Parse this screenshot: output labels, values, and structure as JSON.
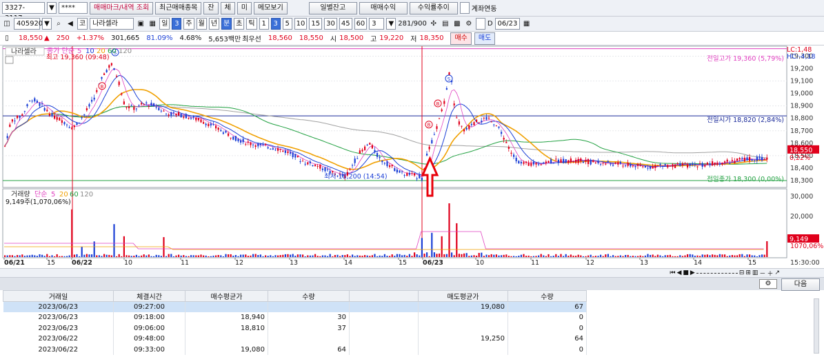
{
  "row1": {
    "screen_no": "3327-3117",
    "password": "****",
    "btn_mark": "매매마크/내역 조회",
    "btn_recent": "최근매매종목",
    "btn_jan": "잔",
    "btn_che": "체",
    "btn_mi": "미",
    "btn_memo": "메모보기",
    "btn_daily": "일별잔고",
    "btn_profit": "매매수익",
    "btn_return": "수익률추이",
    "chk_account": "계좌연동"
  },
  "row2": {
    "code": "405920",
    "prefix": "코",
    "name": "나라셀라",
    "periods": [
      "일",
      "3",
      "주",
      "월",
      "년",
      "분",
      "초",
      "틱"
    ],
    "minutes": [
      "1",
      "3",
      "5",
      "10",
      "15",
      "30",
      "45",
      "60"
    ],
    "count_sel": "3",
    "counter": "281/900",
    "date": "06/23"
  },
  "row3": {
    "price": "18,550",
    "arrow": "▲",
    "change": "250",
    "pct": "+1.37%",
    "volume": "301,665",
    "vol_ratio": "81.09%",
    "turnover_rate": "4.68%",
    "amount": "5,653백만",
    "pri_label": "최우선",
    "ask": "18,560",
    "bid": "18,550",
    "open_label": "시",
    "open": "18,500",
    "high_label": "고",
    "high": "19,220",
    "low_label": "저",
    "low": "18,350",
    "buy_btn": "매수",
    "sell_btn": "매도"
  },
  "price_pane": {
    "title": "나라셀라",
    "legend_prefix": "종가 단순",
    "ma": [
      "5",
      "10",
      "20",
      "60",
      "120"
    ],
    "max_label": "최고 19,360 (09:48)",
    "min_label": "최저 18,200 (14:54)",
    "prev_high": "전일고가 19,360 (5,79%)",
    "prev_open": "전일시가 18,820 (2,84%)",
    "prev_close": "전일종가 18,300 (0,00%)",
    "lc": "LC:1,48",
    "hc": "HC:-4,18",
    "cur_price": "18,550",
    "cur_pct": "0,22%",
    "y_ticks": [
      "19,300",
      "19,200",
      "19,100",
      "19,000",
      "18,900",
      "18,800",
      "18,700",
      "18,600",
      "18,500",
      "18,400",
      "18,300"
    ],
    "marker_s": "S",
    "marker_b": "B"
  },
  "vol_pane": {
    "title": "거래량",
    "legend_prefix": "단순",
    "ma": [
      "5",
      "20",
      "60",
      "120"
    ],
    "vol_label": "9,149주(1,070,06%)",
    "y_ticks": [
      "30,000",
      "20,000",
      "10000"
    ],
    "cur_vol": "9,149",
    "cur_pct": "1070,06%"
  },
  "x_axis": {
    "labels": [
      "06/21",
      "15",
      "06/22",
      "10",
      "11",
      "12",
      "13",
      "14",
      "15",
      "06/23",
      "10",
      "11",
      "12",
      "13",
      "14",
      "15"
    ],
    "time": "15:30:00"
  },
  "bottom": {
    "next_btn": "다음"
  },
  "table": {
    "headers": [
      "거래일",
      "체결시간",
      "매수평균가",
      "수량",
      "",
      "매도평균가",
      "수량"
    ],
    "rows": [
      [
        "2023/06/23",
        "09:27:00",
        "",
        "",
        "",
        "19,080",
        "67"
      ],
      [
        "2023/06/23",
        "09:18:00",
        "18,940",
        "30",
        "",
        "",
        "0"
      ],
      [
        "2023/06/23",
        "09:06:00",
        "18,810",
        "37",
        "",
        "",
        "0"
      ],
      [
        "2023/06/22",
        "09:48:00",
        "",
        "",
        "",
        "19,250",
        "64"
      ],
      [
        "2023/06/22",
        "09:33:00",
        "19,080",
        "64",
        "",
        "",
        "0"
      ]
    ]
  },
  "colors": {
    "up": "#e0001b",
    "down": "#1a3fd6",
    "ma5": "#e040c0",
    "ma10": "#1a3fd6",
    "ma20": "#f0a000",
    "ma60": "#20a040",
    "ma120": "#a0a0a0",
    "arrow": "#e8000a"
  },
  "chart_data": {
    "type": "candlestick",
    "sessions": [
      "06/21",
      "06/22",
      "06/23"
    ],
    "ylim": [
      18250,
      19380
    ],
    "prev_high": 19360,
    "prev_open": 18820,
    "prev_close": 18300,
    "current": 18550,
    "high_mark": 19360,
    "low_mark": 18200,
    "anchors": [
      [
        0,
        18440
      ],
      [
        15,
        18780
      ],
      [
        30,
        18820
      ],
      [
        45,
        18960
      ],
      [
        60,
        18900
      ],
      [
        75,
        18820
      ],
      [
        90,
        18780
      ],
      [
        105,
        18720
      ],
      [
        120,
        18820
      ],
      [
        135,
        18960
      ],
      [
        150,
        19160
      ],
      [
        160,
        19240
      ],
      [
        170,
        19120
      ],
      [
        180,
        18900
      ],
      [
        195,
        18880
      ],
      [
        210,
        18920
      ],
      [
        225,
        18900
      ],
      [
        240,
        18840
      ],
      [
        260,
        18830
      ],
      [
        280,
        18800
      ],
      [
        300,
        18760
      ],
      [
        320,
        18700
      ],
      [
        340,
        18640
      ],
      [
        360,
        18600
      ],
      [
        380,
        18580
      ],
      [
        400,
        18560
      ],
      [
        420,
        18520
      ],
      [
        440,
        18450
      ],
      [
        460,
        18420
      ],
      [
        480,
        18360
      ],
      [
        500,
        18330
      ],
      [
        520,
        18520
      ],
      [
        535,
        18600
      ],
      [
        550,
        18470
      ],
      [
        565,
        18420
      ],
      [
        580,
        18360
      ],
      [
        600,
        18340
      ],
      [
        612,
        18320
      ],
      [
        618,
        18500
      ],
      [
        630,
        18680
      ],
      [
        642,
        18900
      ],
      [
        652,
        19200
      ],
      [
        660,
        18800
      ],
      [
        672,
        18700
      ],
      [
        690,
        18770
      ],
      [
        710,
        18800
      ],
      [
        725,
        18700
      ],
      [
        740,
        18520
      ],
      [
        755,
        18430
      ],
      [
        780,
        18440
      ],
      [
        810,
        18460
      ],
      [
        840,
        18460
      ],
      [
        870,
        18440
      ],
      [
        900,
        18430
      ],
      [
        930,
        18410
      ],
      [
        960,
        18420
      ],
      [
        990,
        18420
      ],
      [
        1020,
        18430
      ],
      [
        1050,
        18450
      ],
      [
        1080,
        18470
      ],
      [
        1110,
        18480
      ]
    ],
    "vol_spikes": [
      [
        104,
        27500
      ],
      [
        118,
        6000
      ],
      [
        134,
        9000
      ],
      [
        164,
        19000
      ],
      [
        178,
        12000
      ],
      [
        237,
        11500
      ],
      [
        612,
        11000
      ],
      [
        626,
        14000
      ],
      [
        640,
        12000
      ],
      [
        652,
        31000
      ],
      [
        660,
        19500
      ],
      [
        1110,
        9149
      ]
    ]
  }
}
